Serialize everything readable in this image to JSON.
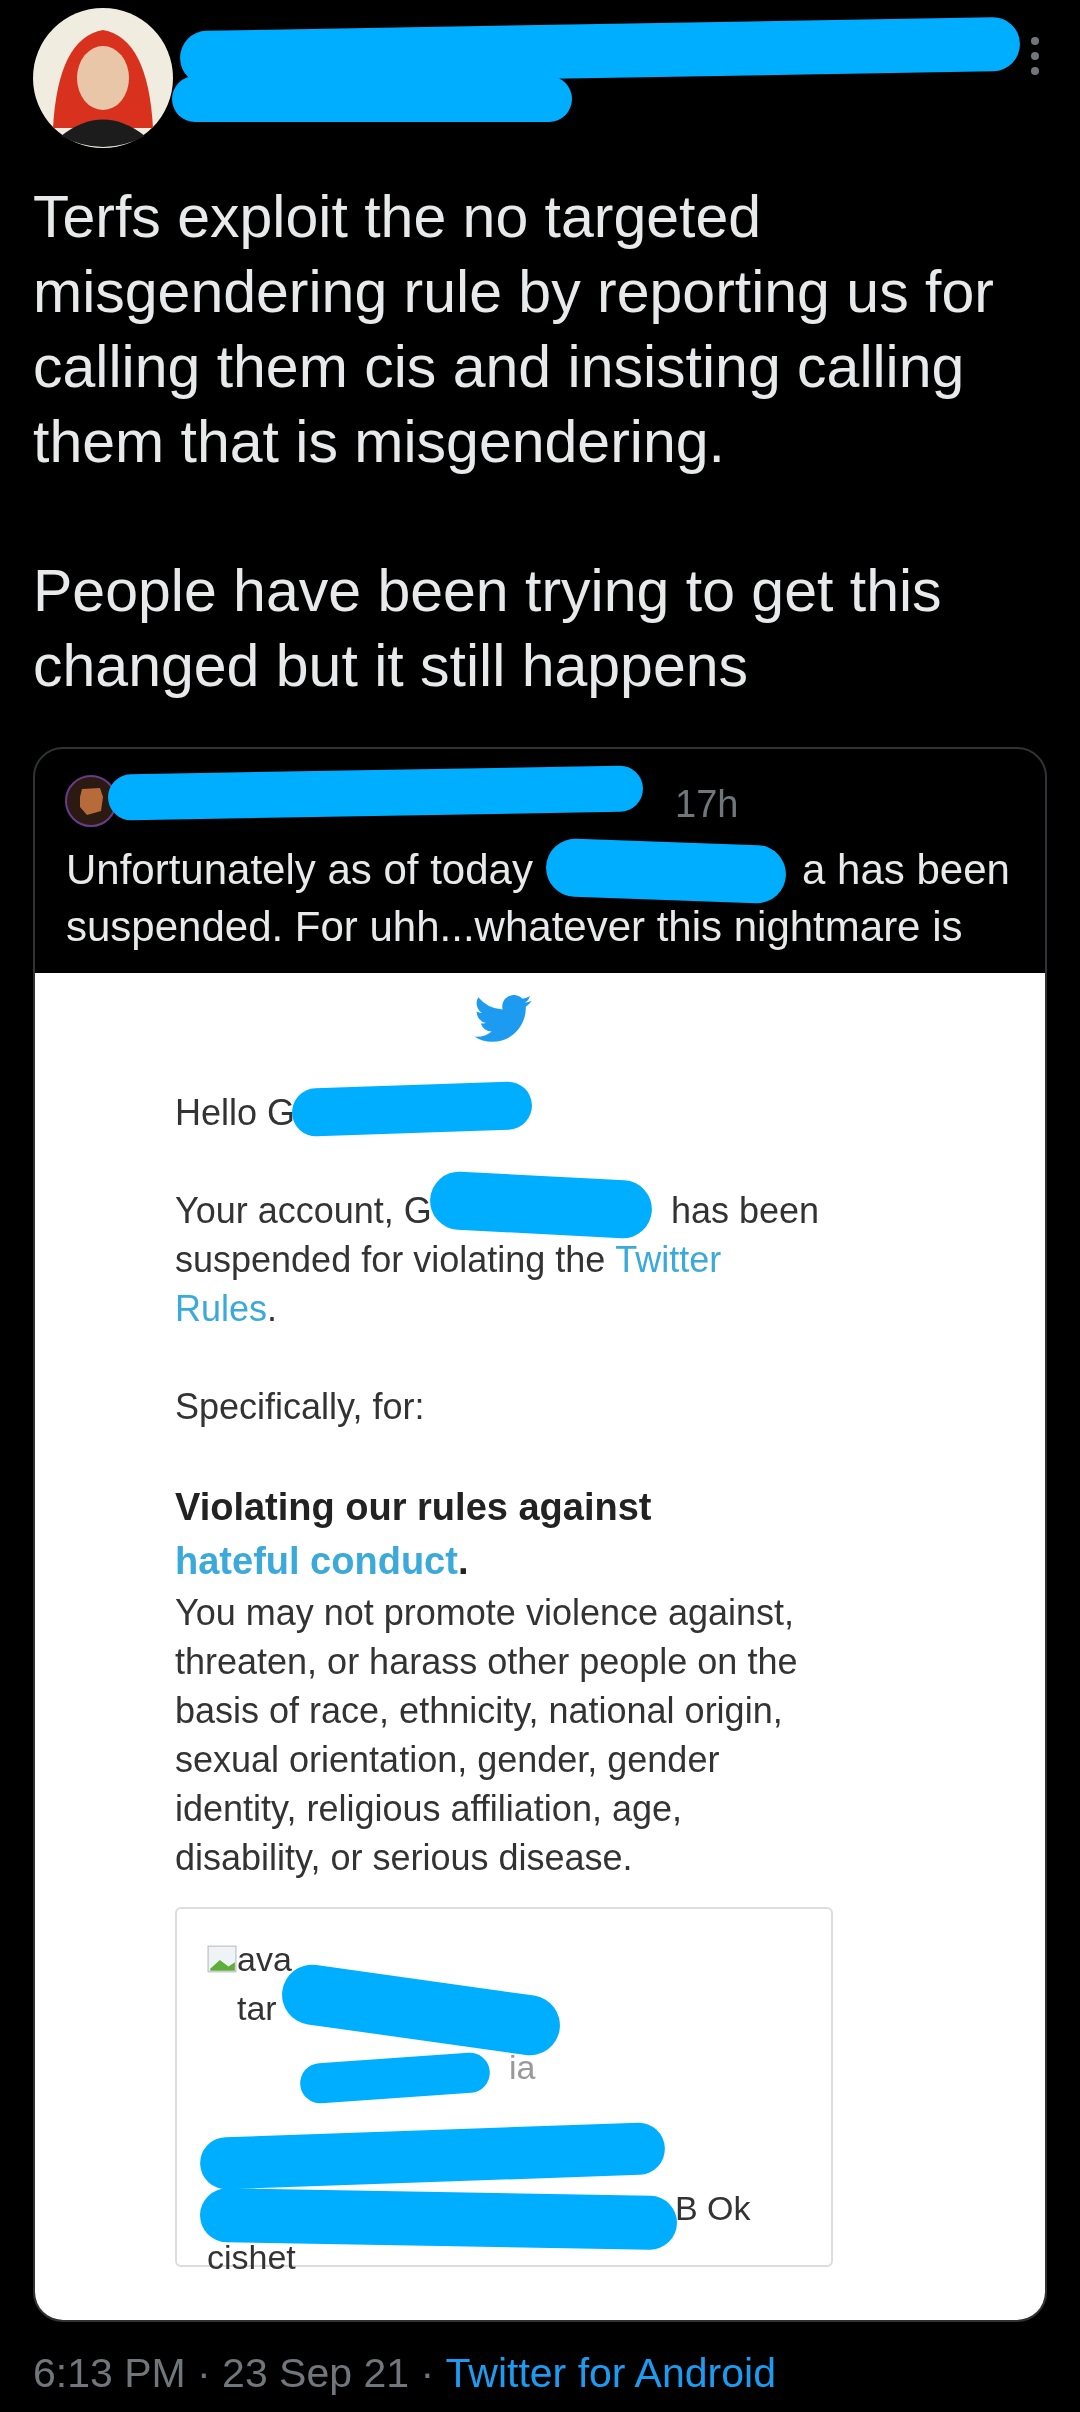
{
  "tweet": {
    "paragraphs": [
      "Terfs exploit the no targeted misgendering rule by reporting us for calling them cis and insisting calling them that is misgendering.",
      "People have been trying to get this changed but it still happens"
    ]
  },
  "quoted_tweet": {
    "time": "17h",
    "text_start": "Unfortunately as of today",
    "text_after_redaction": "a has been",
    "text_end": "suspended. For uhh...whatever this nightmare is",
    "email": {
      "greeting": "Hello G",
      "account_start": "Your account, G",
      "account_end": "has been",
      "violation_text": "suspended for violating the",
      "rules_link_start": "Twitter",
      "rules_link_end": "Rules",
      "rules_period": ".",
      "specifically": "Specifically, for:",
      "heading": "Violating our rules against",
      "heading_link": "hateful conduct",
      "heading_period": ".",
      "body": "You may not promote violence against, threaten, or harass other people on the basis of race, ethnicity, national origin, sexual orientation, gender, gender identity, religious affiliation, age, disability, or serious disease.",
      "embed": {
        "avatar_alt": "avatar",
        "handle_end": "ia",
        "text_end": "B Ok",
        "text_last": "cishet"
      }
    }
  },
  "footer": {
    "meta": "6:13 PM · 23 Sep 21 · ",
    "source": "Twitter for Android"
  }
}
